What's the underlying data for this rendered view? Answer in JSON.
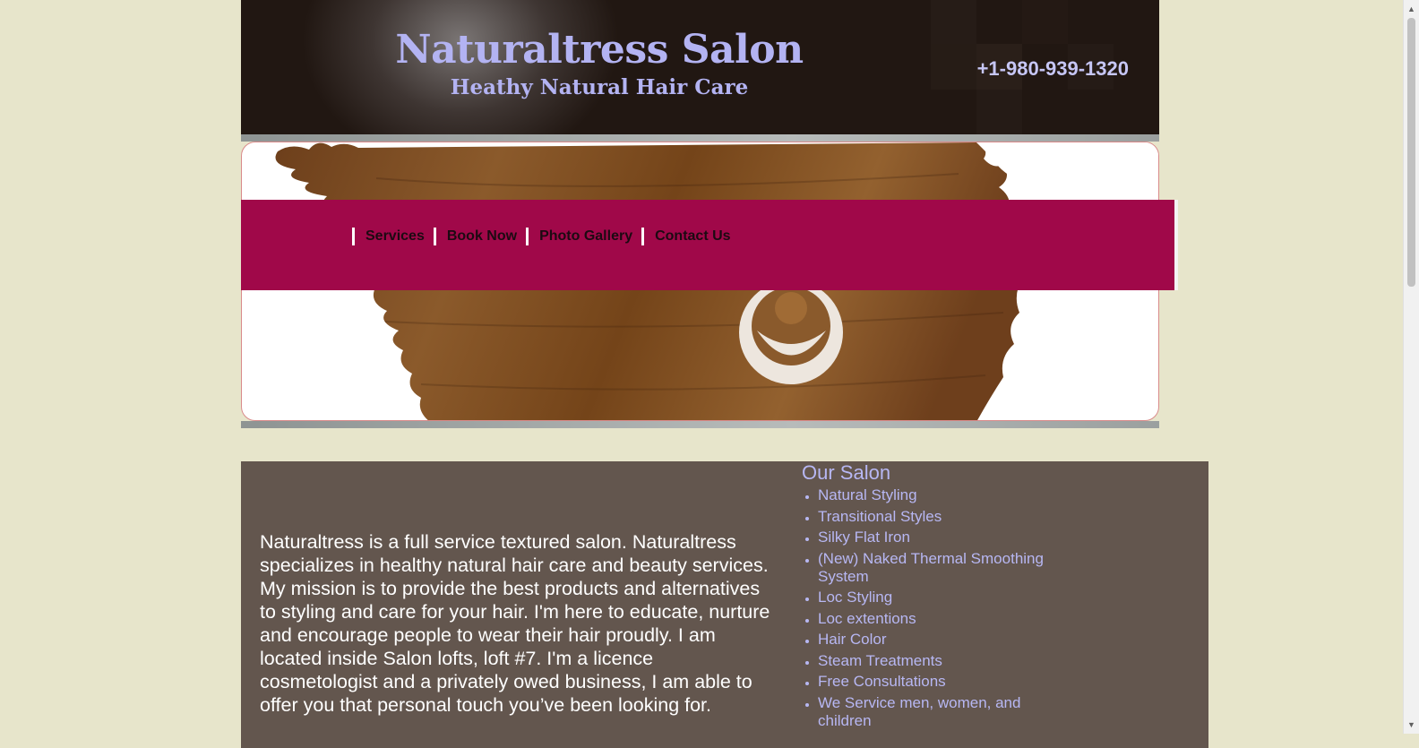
{
  "header": {
    "title": "Naturaltress Salon",
    "subtitle": "Heathy Natural Hair Care",
    "phone": "+1-980-939-1320"
  },
  "nav": {
    "items": [
      "Services",
      "Book Now",
      "Photo Gallery",
      "Contact Us"
    ]
  },
  "main": {
    "intro": "Naturaltress is a full service textured salon. Naturaltress specializes in healthy natural hair care and beauty services. My mission is to provide the best products and alternatives to styling and care for your hair.  I'm here to educate, nurture and encourage people to wear their hair proudly. I am located inside Salon lofts, loft #7. I'm a licence cosmetologist and a privately owed business, I am able to offer you that personal touch you’ve been looking for."
  },
  "sidebar": {
    "title": "Our Salon",
    "items": [
      "Natural Styling",
      "Transitional Styles",
      "Silky Flat Iron",
      "(New) Naked Thermal Smoothing System",
      "Loc Styling",
      "Loc extentions",
      "Hair Color",
      "Steam Treatments",
      "Free Consultations",
      "We Service men, women, and children"
    ]
  },
  "colors": {
    "page_bg": "#e7e5cb",
    "header_bg": "#221712",
    "title_color": "#b3b3f2",
    "nav_bg": "#a00849",
    "content_bg": "#63564e",
    "hair_brown": "#7b4a23"
  },
  "icons": {
    "scroll_up": "chevron-up-icon",
    "scroll_down": "chevron-down-icon"
  }
}
